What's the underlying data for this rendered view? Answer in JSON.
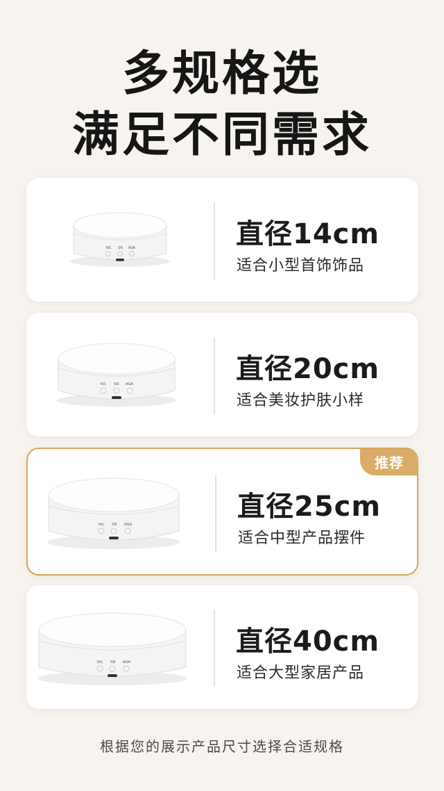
{
  "headline": {
    "line1": "多规格选",
    "line2": "满足不同需求"
  },
  "products": [
    {
      "size": "直径14cm",
      "desc": "适合小型首饰饰品",
      "recommended": false
    },
    {
      "size": "直径20cm",
      "desc": "适合美妆护肤小样",
      "recommended": false
    },
    {
      "size": "直径25cm",
      "desc": "适合中型产品摆件",
      "recommended": true,
      "badge": "推荐"
    },
    {
      "size": "直径40cm",
      "desc": "适合大型家居产品",
      "recommended": false
    }
  ],
  "turntable_labels": {
    "left": "R/L",
    "middle": "SR",
    "right": "ASA"
  },
  "footer": "根据您的展示产品尺寸选择合适规格",
  "colors": {
    "background": "#f7f3ee",
    "accent": "#d4a75f",
    "badge": "#d9ad68"
  }
}
